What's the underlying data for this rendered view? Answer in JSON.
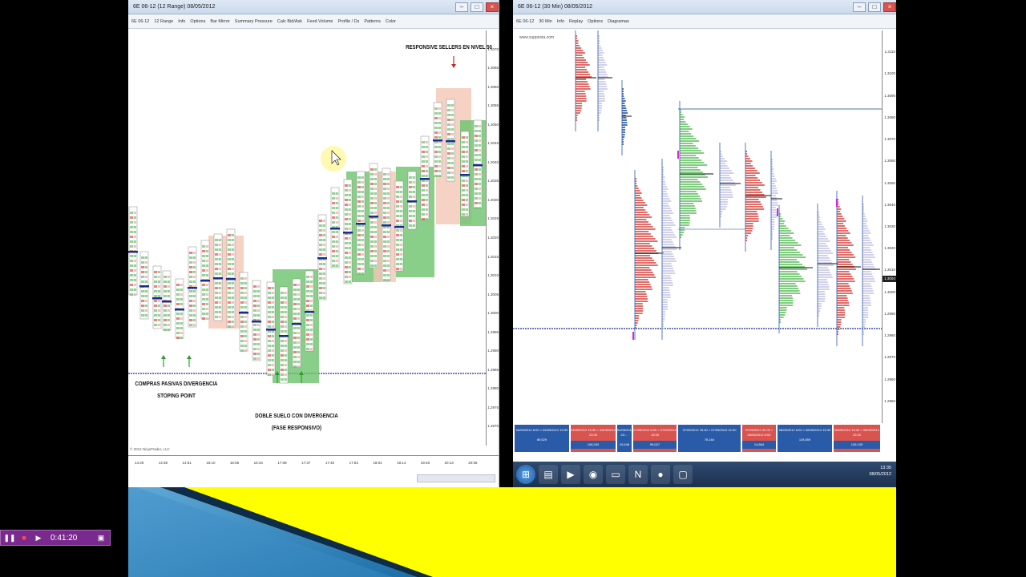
{
  "left_window": {
    "title": "6E 06-12 (12 Range)  08/05/2012",
    "toolbar": [
      "6E 06-12",
      "12 Range",
      "Info",
      "Options",
      "Bar Mirror",
      "Summary Pressure",
      "Calc Bid/Ask",
      "Feed Volume",
      "Profile / Ds",
      "Patterns",
      "Color"
    ],
    "price_ticks": [
      "1.3070",
      "1.3065",
      "1.3060",
      "1.3055",
      "1.3050",
      "1.3045",
      "1.3040",
      "1.3035",
      "1.3030",
      "1.3025",
      "1.3020",
      "1.3015",
      "1.3010",
      "1.3005",
      "1.3000",
      "1.2995",
      "1.2990",
      "1.2985",
      "1.2980",
      "1.2975",
      "1.2970"
    ],
    "time_ticks": [
      "14:28",
      "14:38",
      "14:51",
      "15:10",
      "15:58",
      "16:34",
      "17:08",
      "17:37",
      "17:40",
      "17:53",
      "18:04",
      "18:14",
      "19:48",
      "20:13",
      "20:58"
    ],
    "copyright": "© 2012 NinjaTrader, LLC",
    "annotations": {
      "top": "RESPONSIVE SELLERS EN NIVEL 50",
      "left_line1": "COMPRAS PASIVAS DIVERGENCIA",
      "left_line2": "STOPING POINT",
      "bottom_line1": "DOBLE SUELO CON DIVERGENCIA",
      "bottom_line2": "(FASE RESPONSIVO)"
    }
  },
  "right_window": {
    "title": "6E 06-12 (30 Min)  08/05/2012",
    "toolbar": [
      "6E 06-12",
      "30 Min",
      "Info",
      "Replay",
      "Options",
      "Diagramas"
    ],
    "watermark": "www.suppesta.com",
    "price_ticks": [
      "1.3110",
      "1.3100",
      "1.3090",
      "1.3080",
      "1.3070",
      "1.3060",
      "1.3050",
      "1.3040",
      "1.3030",
      "1.3020",
      "1.3010",
      "1.3000",
      "1.2990",
      "1.2980",
      "1.2970",
      "1.2960",
      "1.2950"
    ],
    "current_price": "1.3004",
    "sessions": [
      {
        "range": "04/05/2012 8:00 > 04/05/2012 15:30",
        "volume": "89,529",
        "color": "#2a5ba8"
      },
      {
        "range": "04/05/2012 15:30 > 04/05/2012 22:00",
        "volume": "108,263",
        "color": "#d9534f"
      },
      {
        "range": "04/05/2012 22:...",
        "volume": "20,548",
        "color": "#2a5ba8"
      },
      {
        "range": "07/05/2012 8:00 > 07/05/2012 15:30",
        "volume": "99,027",
        "color": "#d9534f"
      },
      {
        "range": "07/05/2012 15:30 > 07/05/2012 22:00",
        "volume": "76,164",
        "color": "#2a5ba8"
      },
      {
        "range": "07/05/2012 22:00 > 08/05/2012 8:00",
        "volume": "14,864",
        "color": "#d9534f"
      },
      {
        "range": "08/05/2012 8:00 > 08/05/2012 15:30",
        "volume": "119,859",
        "color": "#2a5ba8"
      },
      {
        "range": "08/05/2012 15:30 > 08/05/2012 22:00",
        "volume": "128,105",
        "color": "#d9534f"
      }
    ]
  },
  "taskbar": {
    "time": "13:35",
    "date": "08/05/2012"
  },
  "player": {
    "time": "0:41:20"
  }
}
